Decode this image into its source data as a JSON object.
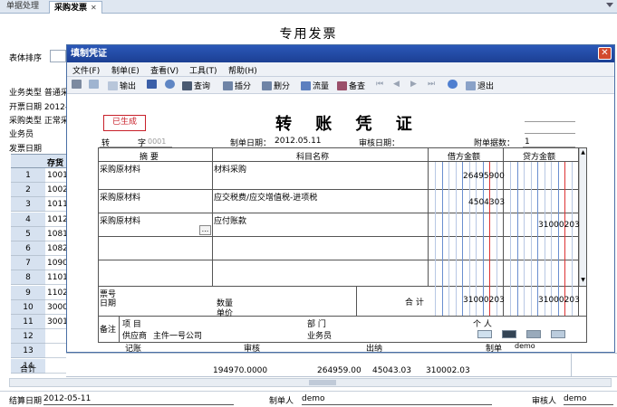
{
  "tabs": [
    {
      "label": "单据处理",
      "active": false
    },
    {
      "label": "采购发票",
      "active": true,
      "close": "✕"
    }
  ],
  "background_form": {
    "title": "专用发票",
    "sort_label": "表体排序",
    "fields": [
      {
        "label": "业务类型",
        "value": "普通采"
      },
      {
        "label": "开票日期",
        "value": "2012-"
      },
      {
        "label": "采购类型",
        "value": "正常采"
      },
      {
        "label": "业务员",
        "value": ""
      },
      {
        "label": "发票日期",
        "value": ""
      }
    ],
    "grid_header": "存货",
    "rows": [
      {
        "num": "1",
        "code": "1001"
      },
      {
        "num": "2",
        "code": "1002"
      },
      {
        "num": "3",
        "code": "1011"
      },
      {
        "num": "4",
        "code": "1012"
      },
      {
        "num": "5",
        "code": "1081"
      },
      {
        "num": "6",
        "code": "1082"
      },
      {
        "num": "7",
        "code": "1090"
      },
      {
        "num": "8",
        "code": "1101"
      },
      {
        "num": "9",
        "code": "1102"
      },
      {
        "num": "10",
        "code": "3000"
      },
      {
        "num": "11",
        "code": "3001"
      },
      {
        "num": "12",
        "code": ""
      },
      {
        "num": "13",
        "code": ""
      },
      {
        "num": "14",
        "code": ""
      }
    ],
    "total_label": "合计",
    "totals": [
      "194970.0000",
      "264959.00",
      "45043.03",
      "310002.03"
    ],
    "status": {
      "settle_date_label": "结算日期",
      "settle_date": "2012-05-11",
      "maker_label": "制单人",
      "maker": "demo",
      "auditor_label": "审核人",
      "auditor": "demo"
    }
  },
  "dialog": {
    "title": "填制凭证",
    "close_icon": "close-icon",
    "menu": [
      "文件(F)",
      "制单(E)",
      "查看(V)",
      "工具(T)",
      "帮助(H)"
    ],
    "toolbar": [
      {
        "label": "",
        "icon": "print-icon"
      },
      {
        "label": "",
        "icon": "preview-icon"
      },
      {
        "label": "输出",
        "icon": "export-icon"
      },
      {
        "label": "",
        "icon": "save-icon"
      },
      {
        "label": "",
        "icon": "undo-icon"
      },
      {
        "label": "查询",
        "icon": "binoculars-icon"
      },
      {
        "label": "插分",
        "icon": "insert-icon"
      },
      {
        "label": "删分",
        "icon": "delete-icon"
      },
      {
        "label": "流量",
        "icon": "flow-icon"
      },
      {
        "label": "备查",
        "icon": "memo-icon"
      },
      {
        "label": "",
        "icon": "first-icon"
      },
      {
        "label": "",
        "icon": "prev-icon"
      },
      {
        "label": "",
        "icon": "next-icon"
      },
      {
        "label": "",
        "icon": "last-icon"
      },
      {
        "label": "",
        "icon": "help-icon"
      },
      {
        "label": "退出",
        "icon": "exit-icon"
      }
    ],
    "voucher": {
      "stamp": "已生成",
      "title": "转 账 凭 证",
      "type_char": "转",
      "number_label": "字",
      "number": "0001",
      "date_label": "制单日期：",
      "date": "2012.05.11",
      "audit_date_label": "审核日期：",
      "attach_label": "附单据数：",
      "attach_count": "1",
      "headers": {
        "summary": "摘 要",
        "account": "科目名称",
        "debit": "借方金额",
        "credit": "贷方金额"
      },
      "entries": [
        {
          "summary": "采购原材料",
          "account": "材料采购",
          "debit": "26495900",
          "credit": ""
        },
        {
          "summary": "采购原材料",
          "account": "应交税费/应交增值税-进项税",
          "debit": "4504303",
          "credit": ""
        },
        {
          "summary": "采购原材料",
          "account": "应付账款",
          "debit": "",
          "credit": "31000203"
        },
        {
          "summary": "",
          "account": "",
          "debit": "",
          "credit": ""
        },
        {
          "summary": "",
          "account": "",
          "debit": "",
          "credit": ""
        }
      ],
      "ellipsis": "...",
      "ticket_label": "票号",
      "ticket_date_label": "日期",
      "qty_label": "数量",
      "price_label": "单价",
      "sum_label": "合 计",
      "sum_debit": "31000203",
      "sum_credit": "31000203",
      "remark_label": "备注",
      "project_label": "项 目",
      "dept_label": "部 门",
      "person_label": "个 人",
      "supplier_label": "供应商",
      "supplier": "主件一号公司",
      "salesman_label": "业务员",
      "footer": {
        "bookkeeper_label": "记账",
        "audit_label": "审核",
        "cashier_label": "出纳",
        "maker_label": "制单",
        "maker": "demo"
      }
    }
  }
}
